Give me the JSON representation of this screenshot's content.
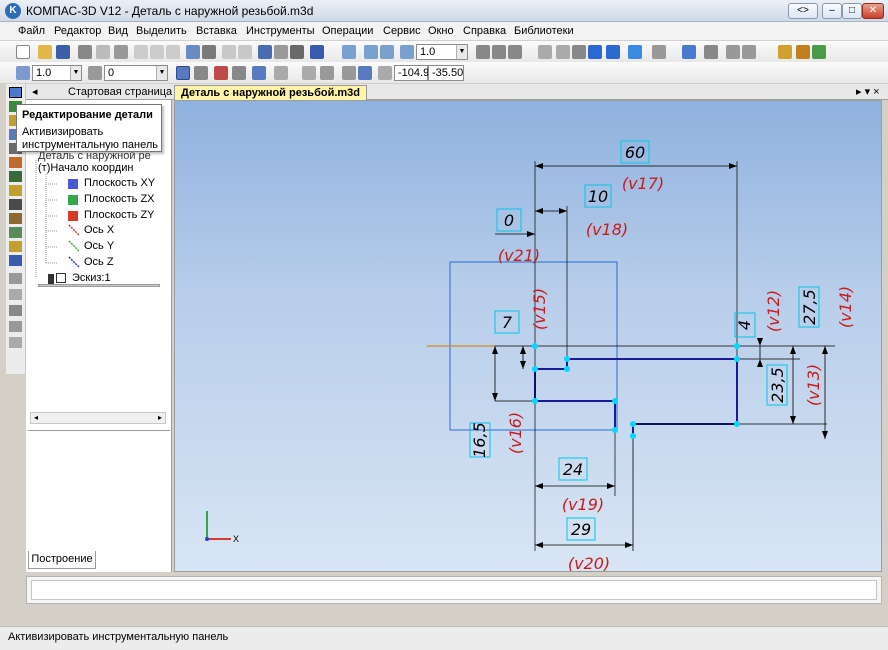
{
  "window": {
    "app_icon_letter": "K",
    "title": "КОМПАС-3D V12 - Деталь с наружной резьбой.m3d",
    "buttons": {
      "restore": "<>",
      "minimize": "–",
      "maximize": "□",
      "close": "✕"
    }
  },
  "menu": {
    "items": [
      "Файл",
      "Редактор",
      "Вид",
      "Выделить",
      "Вставка",
      "Инструменты",
      "Операции",
      "Сервис",
      "Окно",
      "Справка",
      "Библиотеки"
    ]
  },
  "toolbar1": {
    "zoom_value": "1.0"
  },
  "toolbar2": {
    "line_scale": "1.0",
    "layer_value": "0",
    "coord_x": "-104.9",
    "coord_y": "-35.50"
  },
  "tabs": {
    "start_page": "Стартовая страница",
    "active_doc": "Деталь с наружной резьбой.m3d",
    "nav_right": "▸ ▾ ×",
    "nav_left": "◂"
  },
  "tooltip": {
    "title": "Редактирование детали",
    "body": "Активизировать инструментальную панель"
  },
  "tree": {
    "root": "Деталь с наружной ре",
    "origin": "(т)Начало координ",
    "items": [
      {
        "label": "Плоскость XY",
        "color": "#4a5bd6"
      },
      {
        "label": "Плоскость ZX",
        "color": "#3aa64a"
      },
      {
        "label": "Плоскость ZY",
        "color": "#d63a2a"
      },
      {
        "label": "Ось X",
        "color": "#d63a2a"
      },
      {
        "label": "Ось Y",
        "color": "#3aa64a"
      },
      {
        "label": "Ось Z",
        "color": "#2a3ad6"
      }
    ],
    "sketch": "Эскиз:1"
  },
  "panel_tab": "Построение",
  "triad": {
    "x_label": "X"
  },
  "sketch": {
    "dims": [
      {
        "value": "60",
        "var": "(v17)"
      },
      {
        "value": "10",
        "var": "(v18)"
      },
      {
        "value": "0",
        "var": "(v21)"
      },
      {
        "value": "7",
        "var": "(v15)"
      },
      {
        "value": "16,5",
        "var": "(v16)"
      },
      {
        "value": "24",
        "var": "(v19)"
      },
      {
        "value": "29",
        "var": "(v20)"
      },
      {
        "value": "4",
        "var": "(v12)"
      },
      {
        "value": "27,5",
        "var": "(v14)"
      },
      {
        "value": "23,5",
        "var": "(v13)"
      }
    ],
    "colors": {
      "contour": "#1a1a9c",
      "dimension": "#000000",
      "variable": "#cc1a1a",
      "box_border": "#00c8e6",
      "point": "#00d8ff",
      "axis": "#d08a2a"
    }
  },
  "status": {
    "text": "Активизировать инструментальную панель"
  }
}
